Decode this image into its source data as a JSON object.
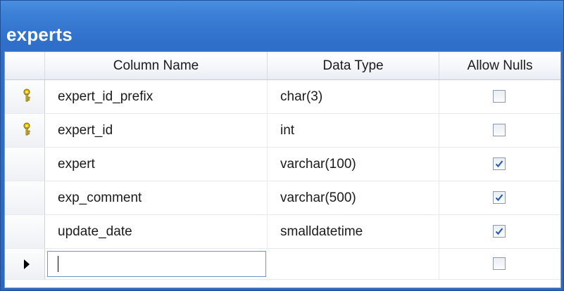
{
  "table": {
    "name": "experts",
    "columns_header": {
      "column_name": "Column Name",
      "data_type": "Data Type",
      "allow_nulls": "Allow Nulls"
    },
    "rows": [
      {
        "column_name": "expert_id_prefix",
        "data_type": "char(3)",
        "allow_nulls": false,
        "primary_key": true
      },
      {
        "column_name": "expert_id",
        "data_type": "int",
        "allow_nulls": false,
        "primary_key": true
      },
      {
        "column_name": "expert",
        "data_type": "varchar(100)",
        "allow_nulls": true,
        "primary_key": false
      },
      {
        "column_name": "exp_comment",
        "data_type": "varchar(500)",
        "allow_nulls": true,
        "primary_key": false
      },
      {
        "column_name": "update_date",
        "data_type": "smalldatetime",
        "allow_nulls": true,
        "primary_key": false
      }
    ],
    "new_row": {
      "column_name": "",
      "data_type": "",
      "allow_nulls": false
    }
  },
  "icons": {
    "primary_key": "key-icon",
    "current_row": "row-pointer-icon",
    "checked": "checkmark-icon"
  },
  "colors": {
    "title_bar": "#2f6fc9",
    "title_text": "#ffffff",
    "key_icon": "#e8c400",
    "checkmark": "#2a5db0"
  }
}
